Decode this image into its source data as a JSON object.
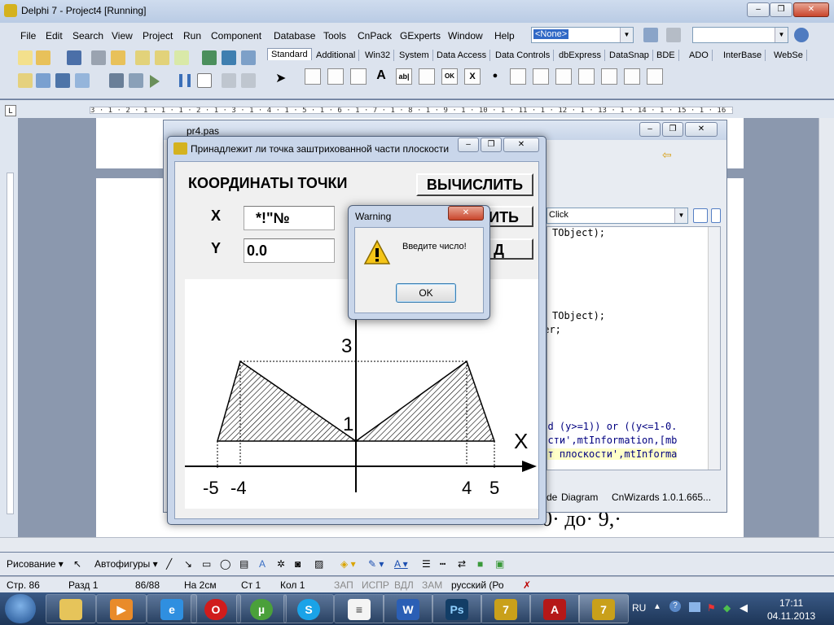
{
  "ide": {
    "title": "Delphi 7 - Project4 [Running]",
    "menu": [
      "File",
      "Edit",
      "Search",
      "View",
      "Project",
      "Run",
      "Component",
      "Database",
      "Tools",
      "CnPack",
      "GExperts",
      "Window",
      "Help"
    ],
    "config_combo": "<None>",
    "palette_tabs": [
      "Standard",
      "Additional",
      "Win32",
      "System",
      "Data Access",
      "Data Controls",
      "dbExpress",
      "DataSnap",
      "BDE",
      "ADO",
      "InterBase",
      "WebSe"
    ],
    "palette_icons": [
      "A",
      "ab|",
      "OK",
      "X",
      "●"
    ]
  },
  "ruler": {
    "marks": "3 · 1 · 2 · 1 · 1 · 1 · 2 · 1 · 3 · 1 · 4 · 1 · 5 · 1 · 6 · 1 · 7 · 1 · 8 · 1 · 9 · 1 · 10 · 1 · 11 · 1 · 12 · 1 · 13 · 1 · 14 · 1 · 15 · 1 · 16 · 1 · 17 · 1"
  },
  "editor": {
    "title": "pr4.pas",
    "event_combo": "Click",
    "code_lines": [
      "TObject);",
      "",
      "",
      "",
      "",
      "",
      "TObject);",
      "ger;",
      "",
      "",
      "",
      "",
      "",
      "and (y>=1)) or ((y<=1-0.",
      "кости',mtInformation,[mb",
      "жит плоскости',mtInforma"
    ],
    "tabs": [
      "de",
      "Diagram",
      "CnWizards  1.0.1.665..."
    ]
  },
  "doc_text": "· 0· до· 9,·",
  "form": {
    "title": "Принадлежит ли точка заштрихованной части плоскости",
    "heading": "КООРДИНАТЫ ТОЧКИ",
    "calc_button": "ВЫЧИСЛИТЬ",
    "x_label": "X",
    "y_label": "Y",
    "x_value": "*!\"№",
    "y_value": "0.0",
    "button2_fragment": "ИТЬ",
    "button3_fragment": "Д",
    "graph": {
      "x_axis_label": "X",
      "y_tick_top": "3",
      "y_tick_mid": "1",
      "x_ticks": [
        "-5",
        "-4",
        "4",
        "5"
      ]
    }
  },
  "dialog": {
    "title": "Warning",
    "message": "Введите число!",
    "ok_label": "OK"
  },
  "drawing_bar": {
    "draw_label": "Рисование ▾",
    "autoshapes_label": "Автофигуры ▾"
  },
  "status_bar": {
    "page": "Стр. 86",
    "section": "Разд 1",
    "pages": "86/88",
    "at": "На 2см",
    "line": "Ст 1",
    "col": "Кол 1",
    "rec": "ЗАП",
    "trk": "ИСПР",
    "ext": "ВДЛ",
    "ovr": "ЗАМ",
    "lang": "русский (Ро"
  },
  "taskbar": {
    "lang": "RU",
    "time": "17:11",
    "date": "04.11.2013",
    "apps": [
      "Explorer",
      "Media Player",
      "Internet Explorer",
      "Opera",
      "uTorrent",
      "Skype",
      "Notes",
      "Word",
      "Photoshop",
      "Delphi 7",
      "Acrobat",
      "Delphi 7 App"
    ]
  }
}
